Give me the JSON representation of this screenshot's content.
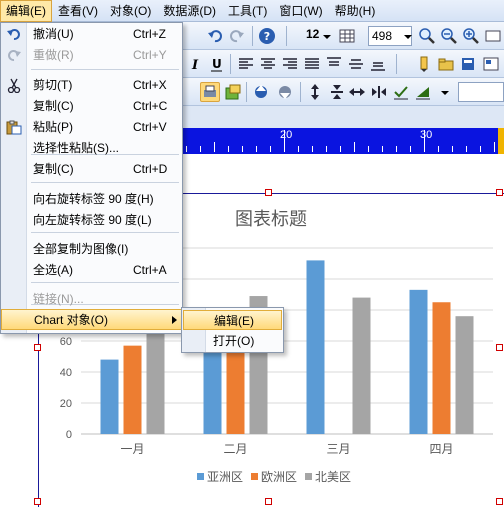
{
  "menubar": {
    "items": [
      "编辑(E)",
      "查看(V)",
      "对象(O)",
      "数据源(D)",
      "工具(T)",
      "窗口(W)",
      "帮助(H)"
    ]
  },
  "toolbar": {
    "font_size": "12",
    "zoom_value": "498"
  },
  "ruler": {
    "labels": [
      "20",
      "30"
    ]
  },
  "edit_menu": {
    "items": [
      {
        "label": "撤消(U)",
        "shortcut": "Ctrl+Z",
        "icon": "undo-icon",
        "enabled": true
      },
      {
        "label": "重做(R)",
        "shortcut": "Ctrl+Y",
        "icon": "redo-icon",
        "enabled": false
      },
      {
        "label": "剪切(T)",
        "shortcut": "Ctrl+X",
        "icon": "cut-icon",
        "enabled": true
      },
      {
        "label": "复制(C)",
        "shortcut": "Ctrl+C",
        "icon": "copy-icon",
        "enabled": true
      },
      {
        "label": "粘贴(P)",
        "shortcut": "Ctrl+V",
        "icon": "paste-icon",
        "enabled": true
      },
      {
        "label": "选择性粘贴(S)...",
        "shortcut": "",
        "icon": "",
        "enabled": true
      },
      {
        "label": "复制(C)",
        "shortcut": "Ctrl+D",
        "icon": "",
        "enabled": true
      },
      {
        "label": "向右旋转标签 90 度(H)",
        "shortcut": "",
        "icon": "",
        "enabled": true
      },
      {
        "label": "向左旋转标签 90 度(L)",
        "shortcut": "",
        "icon": "",
        "enabled": true
      },
      {
        "label": "全部复制为图像(I)",
        "shortcut": "",
        "icon": "",
        "enabled": true
      },
      {
        "label": "全选(A)",
        "shortcut": "Ctrl+A",
        "icon": "",
        "enabled": true
      },
      {
        "label": "链接(N)...",
        "shortcut": "",
        "icon": "",
        "enabled": false
      },
      {
        "label": "Chart 对象(O)",
        "shortcut": "",
        "icon": "",
        "enabled": true,
        "highlighted": true,
        "submenu": true
      }
    ]
  },
  "chart_submenu": {
    "items": [
      {
        "label": "编辑(E)",
        "highlighted": true
      },
      {
        "label": "打开(O)",
        "highlighted": false
      }
    ]
  },
  "chart_data": {
    "type": "bar",
    "title": "图表标题",
    "categories": [
      "一月",
      "二月",
      "三月",
      "四月"
    ],
    "series": [
      {
        "name": "亚洲区",
        "color": "#5b9bd5",
        "values": [
          48,
          62,
          112,
          93
        ]
      },
      {
        "name": "欧洲区",
        "color": "#ed7d31",
        "values": [
          57,
          68,
          0,
          85
        ]
      },
      {
        "name": "北美区",
        "color": "#a5a5a5",
        "values": [
          68,
          89,
          88,
          76
        ]
      }
    ],
    "y_ticks": [
      0,
      20,
      40,
      60
    ],
    "ylim": [
      0,
      120
    ],
    "grid": true,
    "legend_position": "bottom"
  }
}
